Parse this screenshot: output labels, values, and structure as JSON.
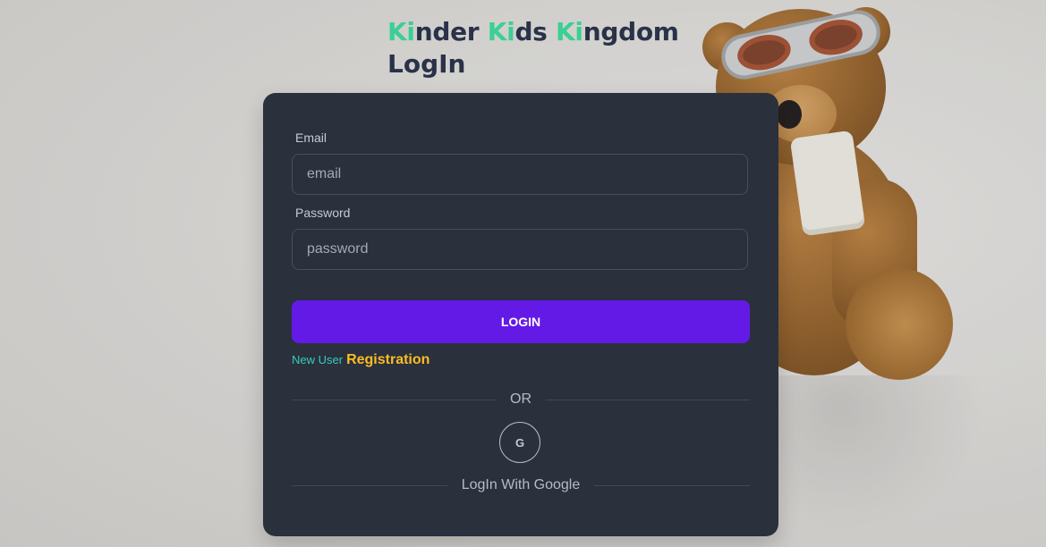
{
  "header": {
    "brand_parts": [
      {
        "accent": "Ki",
        "rest": "nder "
      },
      {
        "accent": "Ki",
        "rest": "ds "
      },
      {
        "accent": "Ki",
        "rest": "ngdom"
      }
    ],
    "page_title": "LogIn"
  },
  "form": {
    "email_label": "Email",
    "email_placeholder": "email",
    "email_value": "",
    "password_label": "Password",
    "password_placeholder": "password",
    "password_value": "",
    "login_button": "LOGIN",
    "new_user_text": "New User",
    "registration_link": "Registration",
    "or_text": "OR",
    "google_button_icon": "G",
    "google_text": "LogIn With Google"
  },
  "colors": {
    "card_bg": "#2a303c",
    "primary": "#641ae6",
    "accent_green": "#3bcf94",
    "new_user": "#37cdbe",
    "registration": "#fbbd23",
    "title": "#2a3249"
  },
  "icons": {
    "google": "google-icon"
  }
}
